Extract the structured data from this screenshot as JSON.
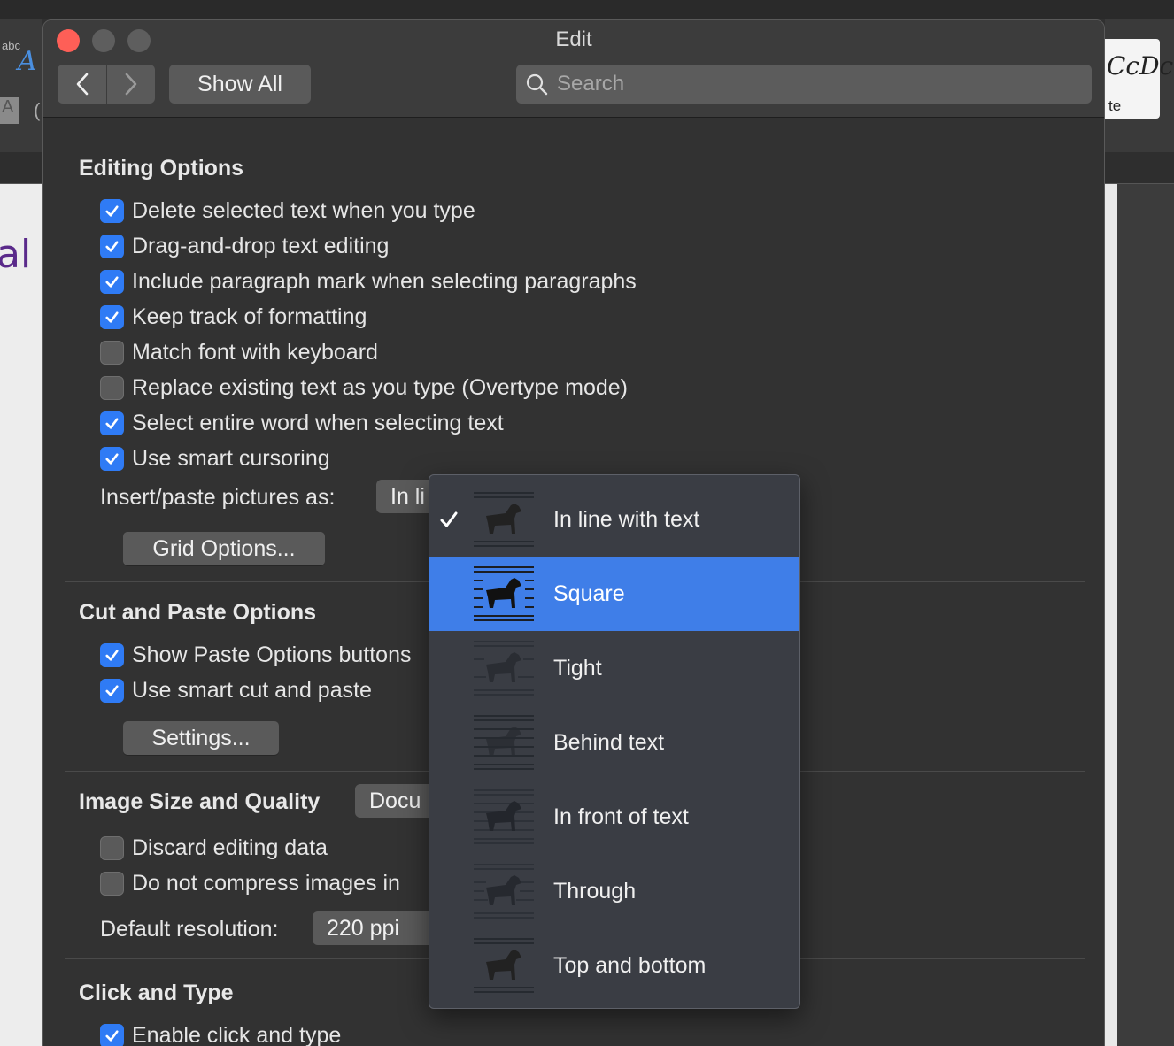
{
  "background": {
    "left_ribbon_text": "abc",
    "left_style_letter": "A",
    "left_doc_text": "al",
    "right_style_sample": "CcDc",
    "right_style_label": "te"
  },
  "window": {
    "title": "Edit",
    "show_all_label": "Show All",
    "search_placeholder": "Search"
  },
  "editing_options": {
    "title": "Editing Options",
    "checkboxes": [
      {
        "label": "Delete selected text when you type",
        "checked": true
      },
      {
        "label": "Drag-and-drop text editing",
        "checked": true
      },
      {
        "label": "Include paragraph mark when selecting paragraphs",
        "checked": true
      },
      {
        "label": "Keep track of formatting",
        "checked": true
      },
      {
        "label": "Match font with keyboard",
        "checked": false
      },
      {
        "label": "Replace existing text as you type (Overtype mode)",
        "checked": false
      },
      {
        "label": "Select entire word when selecting text",
        "checked": true
      },
      {
        "label": "Use smart cursoring",
        "checked": true
      }
    ],
    "insert_paste_label": "Insert/paste pictures as:",
    "insert_paste_value": "In li",
    "grid_options_label": "Grid Options..."
  },
  "cut_paste": {
    "title": "Cut and Paste Options",
    "checkboxes": [
      {
        "label": "Show Paste Options buttons",
        "checked": true
      },
      {
        "label": "Use smart cut and paste",
        "checked": true
      }
    ],
    "settings_label": "Settings..."
  },
  "image_quality": {
    "title": "Image Size and Quality",
    "doc_select_value": "Docu",
    "checkboxes": [
      {
        "label": "Discard editing data",
        "checked": false
      },
      {
        "label": "Do not compress images in",
        "checked": false
      }
    ],
    "resolution_label": "Default resolution:",
    "resolution_value": "220 ppi"
  },
  "click_type": {
    "title": "Click and Type",
    "checkboxes": [
      {
        "label": "Enable click and type",
        "checked": true
      }
    ]
  },
  "wrap_menu": {
    "items": [
      {
        "label": "In line with text",
        "checked": true,
        "highlighted": false,
        "icon": "wrap-inline-icon"
      },
      {
        "label": "Square",
        "checked": false,
        "highlighted": true,
        "icon": "wrap-square-icon"
      },
      {
        "label": "Tight",
        "checked": false,
        "highlighted": false,
        "icon": "wrap-tight-icon"
      },
      {
        "label": "Behind text",
        "checked": false,
        "highlighted": false,
        "icon": "wrap-behind-icon"
      },
      {
        "label": "In front of text",
        "checked": false,
        "highlighted": false,
        "icon": "wrap-front-icon"
      },
      {
        "label": "Through",
        "checked": false,
        "highlighted": false,
        "icon": "wrap-through-icon"
      },
      {
        "label": "Top and bottom",
        "checked": false,
        "highlighted": false,
        "icon": "wrap-top-bottom-icon"
      }
    ]
  },
  "colors": {
    "accent": "#2f7bf5",
    "menu_highlight": "#3f7ee8",
    "close_button": "#fe5f57"
  }
}
